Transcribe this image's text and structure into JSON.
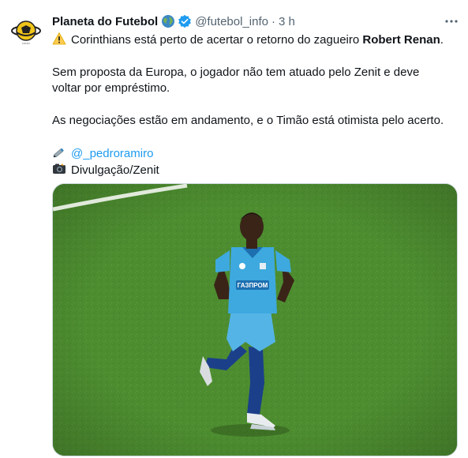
{
  "tweet": {
    "display_name": "Planeta do Futebol",
    "handle": "@futebol_info",
    "separator": "·",
    "time": "3 h",
    "line1_prefix": "Corinthians está perto de acertar o retorno do zagueiro ",
    "line1_bold": "Robert Renan",
    "line1_suffix": ".",
    "paragraph2_a": "Sem proposta da Europa, o jogador não tem atuado pelo Zenit e deve",
    "paragraph2_b": "voltar por empréstimo.",
    "paragraph3": "As negociações estão em andamento, e o Timão está otimista pelo acerto.",
    "mention": "@_pedroramiro",
    "photo_credit": "Divulgação/Zenit"
  },
  "icons": {
    "warning": "warning-icon",
    "globe": "globe-icon",
    "verified": "verified-badge-icon",
    "pen": "pen-icon",
    "camera": "camera-icon",
    "more": "more-options-icon"
  },
  "colors": {
    "accent": "#1d9bf0",
    "secondary_text": "#536471",
    "pitch_green": "#4a8a2e",
    "kit_blue": "#3ea9df"
  }
}
